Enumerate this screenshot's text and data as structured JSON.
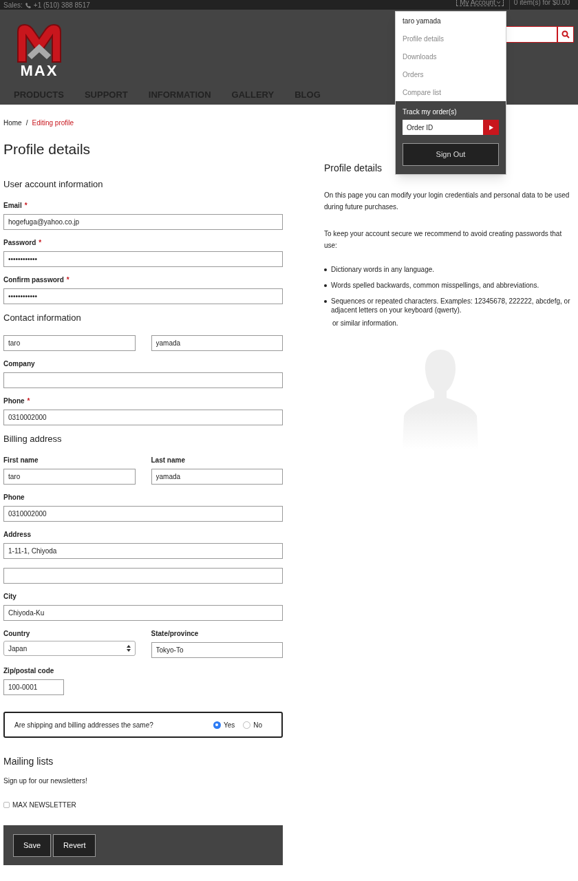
{
  "top_bar": {
    "sales_label": "Sales:",
    "phone": "+1 (510) 388 8517",
    "account": "My Account",
    "cart": "0 item(s) for $0.00"
  },
  "header": {
    "logo_text": "MAX",
    "nav": [
      "PRODUCTS",
      "SUPPORT",
      "INFORMATION",
      "GALLERY",
      "BLOG"
    ]
  },
  "account_menu": {
    "user": "taro yamada",
    "items": [
      "Profile details",
      "Downloads",
      "Orders",
      "Compare list"
    ],
    "track_label": "Track my order(s)",
    "order_placeholder": "Order ID",
    "sign_out": "Sign Out"
  },
  "breadcrumb_separator": "/",
  "breadcrumb": [
    {
      "label": "Home",
      "selected": false
    },
    {
      "label": "Editing profile",
      "selected": true
    }
  ],
  "title": "Profile details",
  "sections": [
    {
      "heading": "User account information",
      "rows": [
        [
          {
            "label": "Email",
            "mark": "*",
            "value": "hogefuga@yahoo.co.jp",
            "kind": "text"
          }
        ],
        [
          {
            "label": "Password",
            "mark": "*",
            "value": "••••••••••••",
            "kind": "text"
          }
        ],
        [
          {
            "label": "Confirm password",
            "mark": "*",
            "value": "••••••••••••",
            "kind": "text"
          }
        ]
      ]
    },
    {
      "heading": "Contact information",
      "rows": [
        [
          {
            "value": "taro",
            "kind": "text"
          },
          {
            "value": "yamada",
            "kind": "text"
          }
        ],
        [
          {
            "label": "Company",
            "kind": "text"
          }
        ],
        [
          {
            "label": "Phone",
            "mark": "*",
            "value": "0310002000",
            "kind": "text"
          }
        ]
      ]
    },
    {
      "heading": "Billing address",
      "rows": [
        [
          {
            "label": "First name",
            "value": "taro",
            "kind": "text"
          },
          {
            "label": "Last name",
            "value": "yamada",
            "kind": "text"
          }
        ],
        [
          {
            "label": "Phone",
            "value": "0310002000",
            "kind": "text"
          }
        ],
        [
          {
            "label": "Address",
            "value": "1-11-1, Chiyoda",
            "kind": "text"
          }
        ],
        [
          {
            "kind": "text"
          }
        ],
        [
          {
            "label": "City",
            "value": "Chiyoda-Ku",
            "kind": "text"
          }
        ],
        [
          {
            "label": "Country",
            "value": "Japan",
            "kind": "select"
          },
          {
            "label": "State/province",
            "value": "Tokyo-To",
            "kind": "text"
          }
        ],
        [
          {
            "label": "Zip/postal code",
            "value": "100-0001",
            "kind": "short"
          }
        ]
      ]
    }
  ],
  "same_address": {
    "question": "Are shipping and billing addresses the same?",
    "options": [
      {
        "label": "Yes",
        "selected": true
      },
      {
        "label": "No",
        "selected": false
      }
    ]
  },
  "mailing": {
    "heading": "Mailing lists",
    "text": "Sign up for our newsletters!",
    "lists": [
      {
        "label": "MAX NEWSLETTER",
        "checked": false
      }
    ]
  },
  "buttons": [
    "Save",
    "Revert"
  ],
  "sidebar": {
    "heading": "Profile details",
    "paragraphs": [
      "On this page you can modify your login credentials and personal data to be used during future purchases.",
      "To keep your account secure we recommend to avoid creating passwords that use:"
    ],
    "bullets": [
      "Dictionary words in any language.",
      "Words spelled backwards, common misspellings, and abbreviations.",
      "Sequences or repeated characters. Examples: 12345678, 222222, abcdefg, or adjacent letters on your keyboard (qwerty)."
    ],
    "note": "or similar information."
  }
}
